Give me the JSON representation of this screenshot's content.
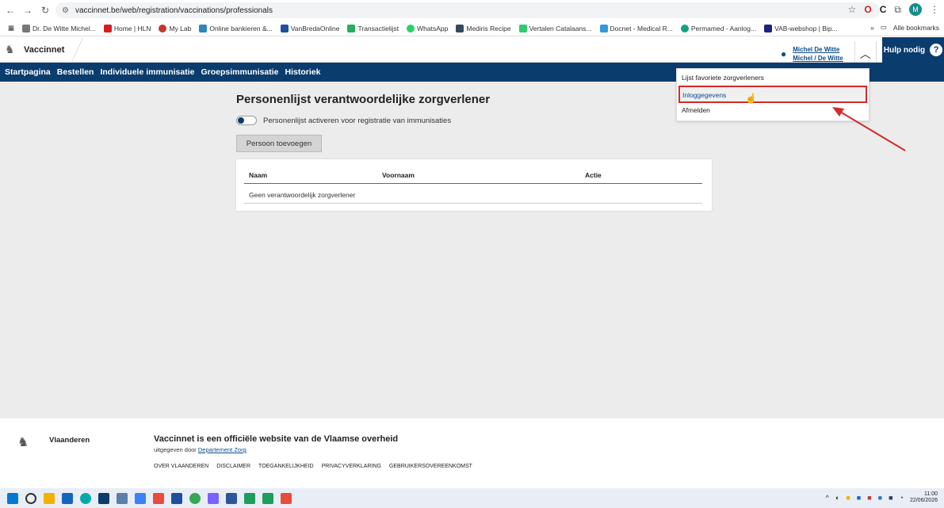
{
  "browser": {
    "url": "vaccinnet.be/web/registration/vaccinations/professionals",
    "bookmarks": [
      "Dr. De Witte Michel...",
      "Home | HLN",
      "My Lab",
      "Online bankieren &...",
      "VanBredaOnline",
      "Transactielijst",
      "WhatsApp",
      "Mediris Recipe",
      "Vertalen Catalaans...",
      "Docnet - Medical R...",
      "Permamed - Aanlog...",
      "VAB-webshop | Bip..."
    ],
    "bookmarks_more": "»",
    "all_bookmarks": "Alle bookmarks",
    "profile_initial": "M"
  },
  "header": {
    "site_name": "Vaccinnet",
    "user_line1": "Michel De Witte",
    "user_line2": "Michel / De Witte",
    "help_label": "Hulp nodig",
    "help_icon": "?"
  },
  "nav": {
    "items": [
      "Startpagina",
      "Bestellen",
      "Individuele immunisatie",
      "Groepsimmunisatie",
      "Historiek"
    ]
  },
  "main": {
    "title": "Personenlijst verantwoordelijke zorgverlener",
    "toggle_label": "Personenlijst activeren voor registratie van immunisaties",
    "add_button": "Persoon toevoegen",
    "table": {
      "headers": [
        "Naam",
        "Voornaam",
        "Actie"
      ],
      "empty_message": "Geen verantwoordelijk zorgverlener"
    }
  },
  "dropdown": {
    "items": [
      "Lijst favoriete zorgverleners",
      "Inloggegevens",
      "Afmelden"
    ]
  },
  "footer": {
    "region": "Vlaanderen",
    "title": "Vaccinnet is een officiële website van de Vlaamse overheid",
    "sub_prefix": "uitgegeven door",
    "sub_link": "Departement Zorg",
    "links": [
      "OVER VLAANDEREN",
      "DISCLAIMER",
      "TOEGANKELIJKHEID",
      "PRIVACYVERKLARING",
      "GEBRUIKERSOVEREENKOMST"
    ]
  },
  "taskbar": {
    "time": "11:00",
    "date": "22/06/2026"
  },
  "colors": {
    "brand_navy": "#0b3c6e",
    "highlight_red": "#d42a2a"
  }
}
